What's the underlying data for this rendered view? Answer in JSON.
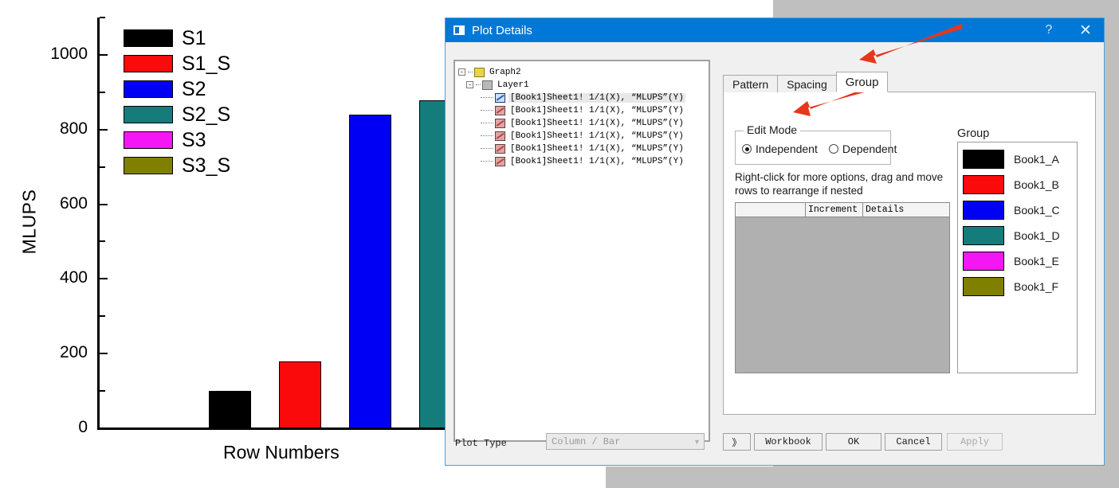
{
  "chart_data": {
    "type": "bar",
    "title": "",
    "xlabel": "Row Numbers",
    "ylabel": "MLUPS",
    "ylim": [
      0,
      1100
    ],
    "yticks": [
      0,
      200,
      400,
      600,
      800,
      1000
    ],
    "ytick_labels": [
      "0",
      "200",
      "400",
      "600",
      "800",
      "1000"
    ],
    "grid": false,
    "legend_position": "top-left",
    "categories": [
      "S1",
      "S1_S",
      "S2",
      "S2_S",
      "S3",
      "S3_S"
    ],
    "values": [
      101,
      179,
      841,
      879,
      null,
      null
    ],
    "colors": [
      "#000000",
      "#fa0a0a",
      "#0000f5",
      "#157c7c",
      "#f516f5",
      "#808000"
    ],
    "legend": [
      {
        "label": "S1",
        "color": "#000000"
      },
      {
        "label": "S1_S",
        "color": "#fa0a0a"
      },
      {
        "label": "S2",
        "color": "#0000f5"
      },
      {
        "label": "S2_S",
        "color": "#157c7c"
      },
      {
        "label": "S3",
        "color": "#f516f5"
      },
      {
        "label": "S3_S",
        "color": "#808000"
      }
    ]
  },
  "dialog": {
    "title": "Plot Details",
    "help_glyph": "?",
    "close_glyph": "✕",
    "tree": {
      "nodes": [
        {
          "indent": 0,
          "icon": "folder",
          "label": "Graph2",
          "expander": "-",
          "selected": false
        },
        {
          "indent": 1,
          "icon": "layer",
          "label": "Layer1",
          "expander": "-",
          "selected": false
        },
        {
          "indent": 2,
          "icon": "plot-selected",
          "label": "[Book1]Sheet1! 1/1(X), “MLUPS”(Y)",
          "expander": "",
          "selected": true
        },
        {
          "indent": 2,
          "icon": "plot",
          "label": "[Book1]Sheet1! 1/1(X), “MLUPS”(Y)",
          "expander": "",
          "selected": false
        },
        {
          "indent": 2,
          "icon": "plot",
          "label": "[Book1]Sheet1! 1/1(X), “MLUPS”(Y)",
          "expander": "",
          "selected": false
        },
        {
          "indent": 2,
          "icon": "plot",
          "label": "[Book1]Sheet1! 1/1(X), “MLUPS”(Y)",
          "expander": "",
          "selected": false
        },
        {
          "indent": 2,
          "icon": "plot",
          "label": "[Book1]Sheet1! 1/1(X), “MLUPS”(Y)",
          "expander": "",
          "selected": false
        },
        {
          "indent": 2,
          "icon": "plot",
          "label": "[Book1]Sheet1! 1/1(X), “MLUPS”(Y)",
          "expander": "",
          "selected": false
        }
      ]
    },
    "tabs": [
      {
        "label": "Pattern",
        "active": false
      },
      {
        "label": "Spacing",
        "active": false
      },
      {
        "label": "Group",
        "active": true
      }
    ],
    "edit_mode": {
      "legend": "Edit Mode",
      "options": [
        {
          "label": "Independent",
          "checked": true
        },
        {
          "label": "Dependent",
          "checked": false
        }
      ]
    },
    "hint": "Right-click for more options, drag and move rows to  rearrange if nested",
    "grid": {
      "columns": [
        "",
        "Increment",
        "Details"
      ],
      "rows": []
    },
    "group": {
      "label": "Group",
      "items": [
        {
          "color": "#000000",
          "name": "Book1_A"
        },
        {
          "color": "#fa0a0a",
          "name": "Book1_B"
        },
        {
          "color": "#0000f5",
          "name": "Book1_C"
        },
        {
          "color": "#157c7c",
          "name": "Book1_D"
        },
        {
          "color": "#f516f5",
          "name": "Book1_E"
        },
        {
          "color": "#808000",
          "name": "Book1_F"
        }
      ]
    },
    "bottom": {
      "plot_type_label": "Plot Type",
      "plot_type_value": "Column / Bar",
      "caret": "▼",
      "more_label": "》",
      "workbook_label": "Workbook",
      "ok_label": "OK",
      "cancel_label": "Cancel",
      "apply_label": "Apply"
    }
  },
  "annotations": {
    "arrow_color": "#e8361c",
    "arrows": [
      {
        "name": "arrow-to-group-tab"
      },
      {
        "name": "arrow-to-edit-mode"
      }
    ]
  }
}
